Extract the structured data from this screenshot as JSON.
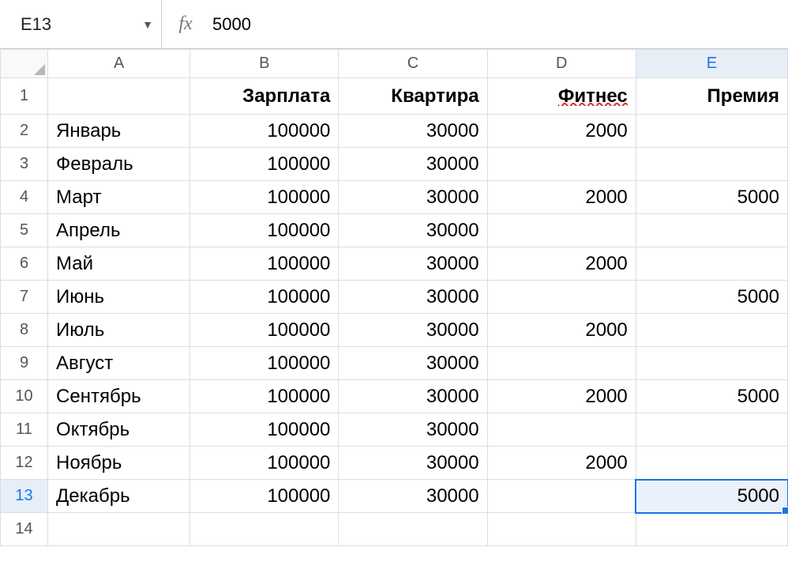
{
  "name_box": "E13",
  "fx_label": "fx",
  "formula_value": "5000",
  "selection": {
    "col": "E",
    "row": 13
  },
  "columns": [
    "A",
    "B",
    "C",
    "D",
    "E"
  ],
  "row_count": 14,
  "headers_row": {
    "A": "",
    "B": "Зарплата",
    "C": "Квартира",
    "D": "Фитнес",
    "E": "Премия"
  },
  "spell_error_cells": [
    "D1"
  ],
  "rows": [
    {
      "n": 2,
      "A": "Январь",
      "B": 100000,
      "C": 30000,
      "D": 2000,
      "E": ""
    },
    {
      "n": 3,
      "A": "Февраль",
      "B": 100000,
      "C": 30000,
      "D": "",
      "E": ""
    },
    {
      "n": 4,
      "A": "Март",
      "B": 100000,
      "C": 30000,
      "D": 2000,
      "E": 5000
    },
    {
      "n": 5,
      "A": "Апрель",
      "B": 100000,
      "C": 30000,
      "D": "",
      "E": ""
    },
    {
      "n": 6,
      "A": "Май",
      "B": 100000,
      "C": 30000,
      "D": 2000,
      "E": ""
    },
    {
      "n": 7,
      "A": "Июнь",
      "B": 100000,
      "C": 30000,
      "D": "",
      "E": 5000
    },
    {
      "n": 8,
      "A": "Июль",
      "B": 100000,
      "C": 30000,
      "D": 2000,
      "E": ""
    },
    {
      "n": 9,
      "A": "Август",
      "B": 100000,
      "C": 30000,
      "D": "",
      "E": ""
    },
    {
      "n": 10,
      "A": "Сентябрь",
      "B": 100000,
      "C": 30000,
      "D": 2000,
      "E": 5000
    },
    {
      "n": 11,
      "A": "Октябрь",
      "B": 100000,
      "C": 30000,
      "D": "",
      "E": ""
    },
    {
      "n": 12,
      "A": "Ноябрь",
      "B": 100000,
      "C": 30000,
      "D": 2000,
      "E": ""
    },
    {
      "n": 13,
      "A": "Декабрь",
      "B": 100000,
      "C": 30000,
      "D": "",
      "E": 5000
    }
  ]
}
